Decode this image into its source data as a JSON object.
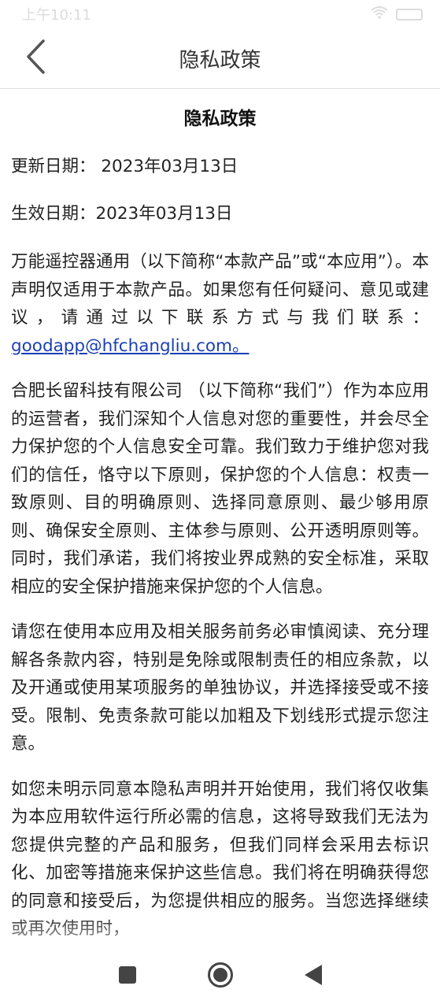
{
  "status_bar": {
    "time": "上午10:11",
    "icons": [
      "wifi-icon",
      "battery-icon"
    ]
  },
  "header": {
    "title": "隐私政策",
    "back_icon": "chevron-left-icon"
  },
  "document": {
    "title": "隐私政策",
    "updated_date": "更新日期： 2023年03月13日",
    "effective_date": "生效日期：2023年03月13日",
    "intro_text": "万能遥控器通用（以下简称“本款产品”或“本应用”）。本声明仅适用于本款产品。如果您有任何疑问、意见或建议，请通过以下联系方式与我们联系： ",
    "contact_email": "goodapp@hfchangliu.com。",
    "paragraph_operator": "合肥长留科技有限公司 （以下简称“我们”）作为本应用的运营者，我们深知个人信息对您的重要性，并会尽全力保护您的个人信息安全可靠。我们致力于维护您对我们的信任，恪守以下原则，保护您的个人信息：权责一致原则、目的明确原则、选择同意原则、最少够用原则、确保安全原则、主体参与原则、公开透明原则等。同时，我们承诺，我们将按业界成熟的安全标准，采取相应的安全保护措施来保护您的个人信息。",
    "paragraph_read": "请您在使用本应用及相关服务前务必审慎阅读、充分理解各条款内容，特别是免除或限制责任的相应条款，以及开通或使用某项服务的单独协议，并选择接受或不接受。限制、免责条款可能以加粗及下划线形式提示您注意。",
    "paragraph_consent": "如您未明示同意本隐私声明并开始使用，我们将仅收集为本应用软件运行所必需的信息，这将导致我们无法为您提供完整的产品和服务，但我们同样会采用去标识化、加密等措施来保护这些信息。我们将在明确获得您的同意和接受后，为您提供相应的服务。当您选择继续或再次使用时，"
  },
  "nav_bar": {
    "buttons": [
      "square-icon",
      "home-circle-icon",
      "back-triangle-icon"
    ]
  }
}
